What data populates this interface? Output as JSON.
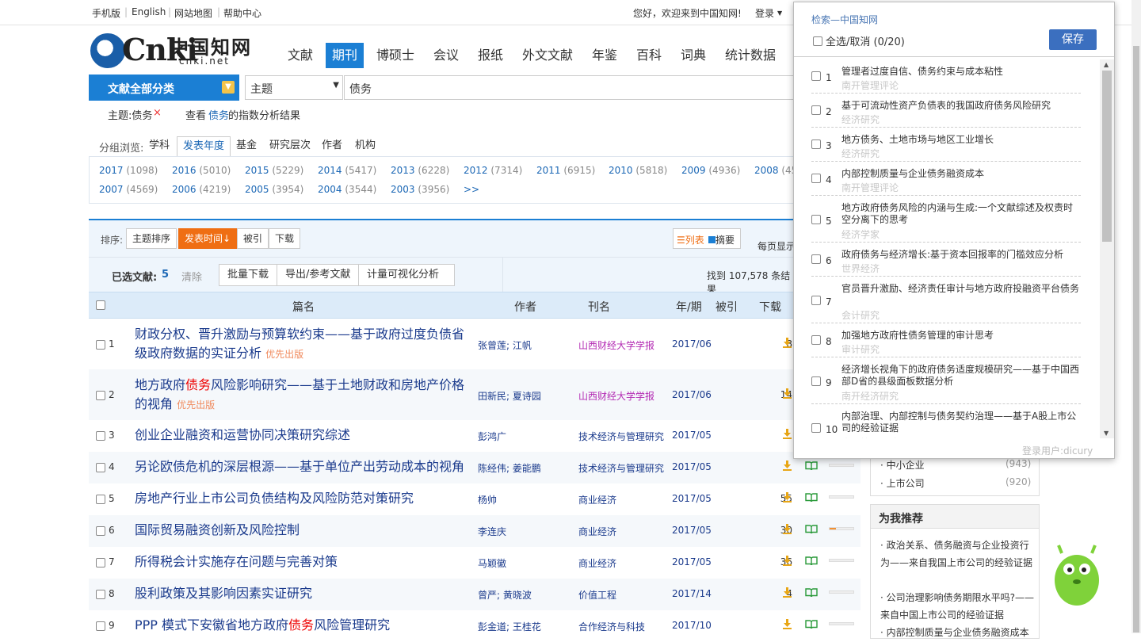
{
  "topbar": {
    "mobile": "手机版",
    "english": "English",
    "sitemap": "网站地图",
    "help": "帮助中心",
    "welcome": "您好，欢迎来到中国知网!",
    "login": "登录"
  },
  "logo": {
    "en": "Cnki",
    "cn": "中国知网",
    "domain": "cnki.net"
  },
  "nav": [
    "文献",
    "期刊",
    "博硕士",
    "会议",
    "报纸",
    "外文文献",
    "年鉴",
    "百科",
    "词典",
    "统计数据"
  ],
  "search": {
    "category_btn": "文献全部分类",
    "field": "主题",
    "query": "债务"
  },
  "crumb": {
    "tag": "主题:债务",
    "remove": "×",
    "view_prefix": "查看",
    "view_term": "债务",
    "view_suffix": "的指数分析结果"
  },
  "group": {
    "label": "分组浏览:",
    "tabs": [
      "学科",
      "发表年度",
      "基金",
      "研究层次",
      "作者",
      "机构"
    ]
  },
  "years": [
    {
      "y": "2017",
      "c": "(1098)"
    },
    {
      "y": "2016",
      "c": "(5010)"
    },
    {
      "y": "2015",
      "c": "(5229)"
    },
    {
      "y": "2014",
      "c": "(5417)"
    },
    {
      "y": "2013",
      "c": "(6228)"
    },
    {
      "y": "2012",
      "c": "(7314)"
    },
    {
      "y": "2011",
      "c": "(6915)"
    },
    {
      "y": "2010",
      "c": "(5818)"
    },
    {
      "y": "2009",
      "c": "(4936)"
    },
    {
      "y": "2008",
      "c": "(45"
    },
    {
      "y": "2007",
      "c": "(4569)"
    },
    {
      "y": "2006",
      "c": "(4219)"
    },
    {
      "y": "2005",
      "c": "(3954)"
    },
    {
      "y": "2004",
      "c": "(3544)"
    },
    {
      "y": "2003",
      "c": "(3956)"
    }
  ],
  "years_more": ">>",
  "sort": {
    "label": "排序:",
    "options": [
      "主题排序",
      "发表时间",
      "被引",
      "下载"
    ],
    "view_list": "列表",
    "view_abs": "摘要",
    "per_page": "每页显示"
  },
  "selection": {
    "label": "已选文献:",
    "count": "5",
    "clear": "清除",
    "batch": "批量下载",
    "export": "导出/参考文献",
    "visual": "计量可视化分析",
    "found": "找到 107,578 条结果"
  },
  "table_headers": [
    "篇名",
    "作者",
    "刊名",
    "年/期",
    "被引",
    "下载"
  ],
  "rows": [
    {
      "n": "1",
      "t1": "财政分权、晋升激励与预算软约束——基于政府过度负债省级政府数据的实证分析",
      "hl": "",
      "t2": "",
      "pri": "优先出版",
      "auth": "张曾莲; 江帆",
      "src": "山西财经大学学报",
      "date": "2017/06",
      "dl": "8",
      "bar": 0
    },
    {
      "n": "2",
      "t1": "地方政府",
      "hl": "债务",
      "t2": "风险影响研究——基于土地财政和房地产价格的视角",
      "pri": "优先出版",
      "auth": "田新民; 夏诗园",
      "src": "山西财经大学学报",
      "date": "2017/06",
      "dl": "14",
      "bar": 0
    },
    {
      "n": "3",
      "t1": "创业企业融资和运营协同决策研究综述",
      "hl": "",
      "t2": "",
      "pri": "",
      "auth": "彭鸿广",
      "src": "技术经济与管理研究",
      "date": "2017/05",
      "dl": "",
      "bar": 0
    },
    {
      "n": "4",
      "t1": "另论欧债危机的深层根源——基于单位产出劳动成本的视角",
      "hl": "",
      "t2": "",
      "pri": "",
      "auth": "陈经伟; 姜能鹏",
      "src": "技术经济与管理研究",
      "date": "2017/05",
      "dl": "",
      "bar": 0
    },
    {
      "n": "5",
      "t1": "房地产行业上市公司负债结构及风险防范对策研究",
      "hl": "",
      "t2": "",
      "pri": "",
      "auth": "杨帅",
      "src": "商业经济",
      "date": "2017/05",
      "dl": "55",
      "bar": 0
    },
    {
      "n": "6",
      "t1": "国际贸易融资创新及风险控制",
      "hl": "",
      "t2": "",
      "pri": "",
      "auth": "李连庆",
      "src": "商业经济",
      "date": "2017/05",
      "dl": "30",
      "bar": 0.25
    },
    {
      "n": "7",
      "t1": "所得税会计实施存在问题与完善对策",
      "hl": "",
      "t2": "",
      "pri": "",
      "auth": "马颖徽",
      "src": "商业经济",
      "date": "2017/05",
      "dl": "36",
      "bar": 0
    },
    {
      "n": "8",
      "t1": "股利政策及其影响因素实证研究",
      "hl": "",
      "t2": "",
      "pri": "",
      "auth": "曾严; 黄晓波",
      "src": "价值工程",
      "date": "2017/14",
      "dl": "4",
      "bar": 0
    },
    {
      "n": "9",
      "t1": "PPP 模式下安徽省地方政府",
      "hl": "债务",
      "t2": "风险管理研究",
      "pri": "",
      "auth": "彭金道; 王桂花",
      "src": "合作经济与科技",
      "date": "2017/10",
      "dl": "",
      "bar": 0
    }
  ],
  "side": {
    "filters": [
      {
        "name": "中小企业",
        "count": "(943)"
      },
      {
        "name": "上市公司",
        "count": "(920)"
      }
    ],
    "rec_title": "为我推荐",
    "recs": [
      "政治关系、债务融资与企业投资行为——来自我国上市公司的经验证据",
      "公司治理影响债务期限水平吗?——来自中国上市公司的经验证据",
      "内部控制质量与企业债务融资成本"
    ]
  },
  "popup": {
    "title": "检索—中国知网",
    "select_all": "全选/取消 (0/20)",
    "save": "保存",
    "user": "登录用户:dicury",
    "items": [
      {
        "n": "1",
        "t": "管理者过度自信、债务约束与成本粘性",
        "s": "南开管理评论"
      },
      {
        "n": "2",
        "t": "基于可流动性资产负债表的我国政府债务风险研究",
        "s": "经济研究"
      },
      {
        "n": "3",
        "t": "地方债务、土地市场与地区工业增长",
        "s": "经济研究"
      },
      {
        "n": "4",
        "t": "内部控制质量与企业债务融资成本",
        "s": "南开管理评论"
      },
      {
        "n": "5",
        "t": "地方政府债务风险的内涵与生成:一个文献综述及权责时空分离下的思考",
        "s": "经济学家"
      },
      {
        "n": "6",
        "t": "政府债务与经济增长:基于资本回报率的门槛效应分析",
        "s": "世界经济"
      },
      {
        "n": "7",
        "t": "官员晋升激励、经济责任审计与地方政府投融资平台债务",
        "s": "会计研究"
      },
      {
        "n": "8",
        "t": "加强地方政府性债务管理的审计思考",
        "s": "审计研究"
      },
      {
        "n": "9",
        "t": "经济增长视角下的政府债务适度规模研究——基于中国西部D省的县级面板数据分析",
        "s": "南开经济研究"
      },
      {
        "n": "10",
        "t": "内部治理、内部控制与债务契约治理——基于A股上市公司的经验证据",
        "s": "南开管理评论"
      }
    ]
  }
}
